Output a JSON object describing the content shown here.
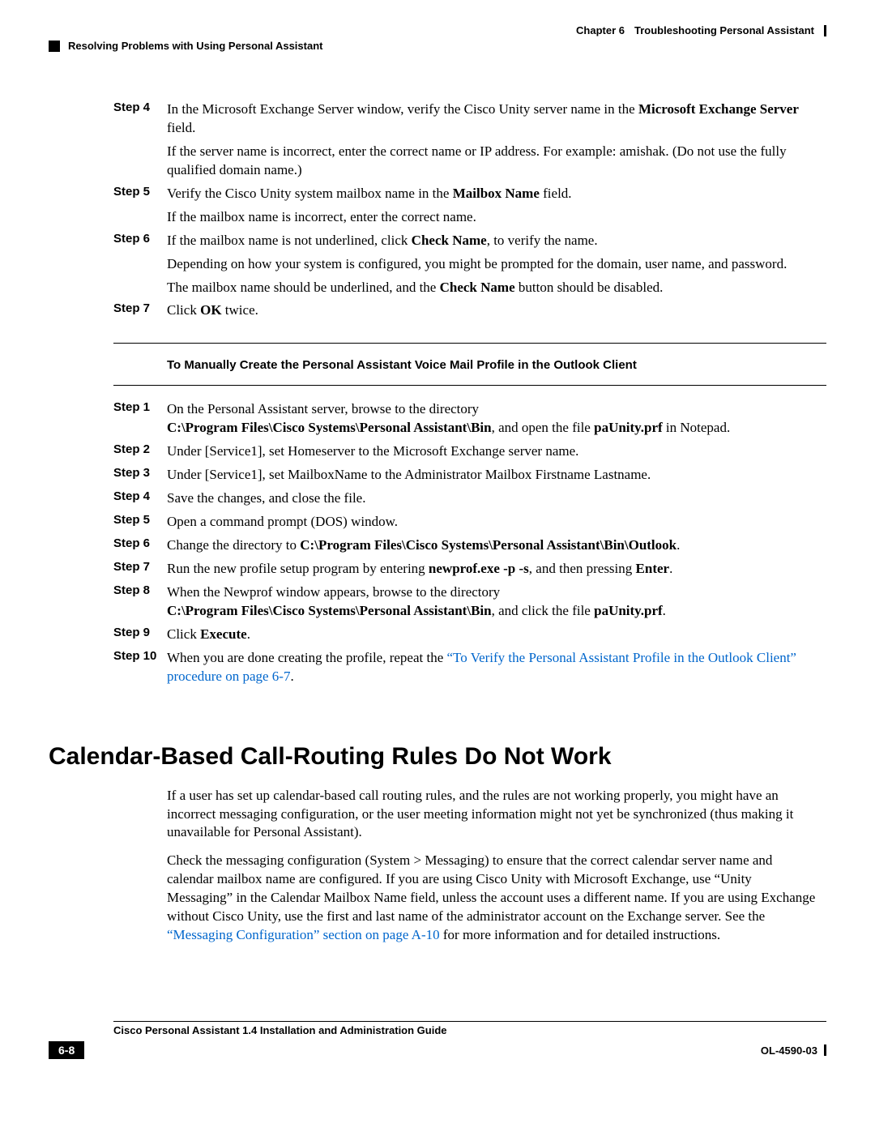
{
  "header": {
    "chapter": "Chapter 6",
    "chapter_title": "Troubleshooting Personal Assistant",
    "section": "Resolving Problems with Using Personal Assistant"
  },
  "steps_a": {
    "s4": {
      "label": "Step 4",
      "t1a": "In the Microsoft Exchange Server window, verify the Cisco Unity server name in the ",
      "t1b": "Microsoft Exchange Server",
      "t1c": " field.",
      "t2": "If the server name is incorrect, enter the correct name or IP address. For example: amishak. (Do not use the fully qualified domain name.)"
    },
    "s5": {
      "label": "Step 5",
      "t1a": "Verify the Cisco Unity system mailbox name in the ",
      "t1b": "Mailbox Name",
      "t1c": " field.",
      "t2": "If the mailbox name is incorrect, enter the correct name."
    },
    "s6": {
      "label": "Step 6",
      "t1a": "If the mailbox name is not underlined, click ",
      "t1b": "Check Name",
      "t1c": ", to verify the name.",
      "t2": "Depending on how your system is configured, you might be prompted for the domain, user name, and password.",
      "t3a": "The mailbox name should be underlined, and the ",
      "t3b": "Check Name",
      "t3c": " button should be disabled."
    },
    "s7": {
      "label": "Step 7",
      "t1a": "Click ",
      "t1b": "OK",
      "t1c": " twice."
    }
  },
  "subheading": "To Manually Create the Personal Assistant Voice Mail Profile in the Outlook Client",
  "steps_b": {
    "s1": {
      "label": "Step 1",
      "t1": "On the Personal Assistant server, browse to the directory ",
      "t2a": "C:\\Program Files\\Cisco Systems\\Personal Assistant\\Bin",
      "t2b": ", and open the file ",
      "t2c": "paUnity.prf",
      "t2d": " in Notepad."
    },
    "s2": {
      "label": "Step 2",
      "t1": "Under [Service1], set Homeserver to the Microsoft Exchange server name."
    },
    "s3": {
      "label": "Step 3",
      "t1": "Under [Service1], set MailboxName to the Administrator Mailbox Firstname Lastname."
    },
    "s4": {
      "label": "Step 4",
      "t1": "Save the changes, and close the file."
    },
    "s5": {
      "label": "Step 5",
      "t1": "Open a command prompt (DOS) window."
    },
    "s6": {
      "label": "Step 6",
      "t1a": "Change the directory to ",
      "t1b": "C:\\Program Files\\Cisco Systems\\Personal Assistant\\Bin\\Outlook",
      "t1c": "."
    },
    "s7": {
      "label": "Step 7",
      "t1a": "Run the new profile setup program by entering ",
      "t1b": "newprof.exe -p -s",
      "t1c": ", and then pressing ",
      "t1d": "Enter",
      "t1e": "."
    },
    "s8": {
      "label": "Step 8",
      "t1": "When the Newprof window appears, browse to the directory ",
      "t2a": "C:\\Program Files\\Cisco Systems\\Personal Assistant\\Bin",
      "t2b": ", and click the file ",
      "t2c": "paUnity.prf",
      "t2d": "."
    },
    "s9": {
      "label": "Step 9",
      "t1a": "Click ",
      "t1b": "Execute",
      "t1c": "."
    },
    "s10": {
      "label": "Step 10",
      "t1a": "When you are done creating the profile, repeat the ",
      "link": "“To Verify the Personal Assistant Profile in the Outlook Client” procedure on page 6-7",
      "t1b": "."
    }
  },
  "h2": "Calendar-Based Call-Routing Rules Do Not Work",
  "para1": "If a user has set up calendar-based call routing rules, and the rules are not working properly, you might have an incorrect messaging configuration, or the user meeting information might not yet be synchronized (thus making it unavailable for Personal Assistant).",
  "para2a": "Check the messaging configuration (System > Messaging) to ensure that the correct calendar server name and calendar mailbox name are configured. If you are using Cisco Unity with Microsoft Exchange, use “Unity Messaging” in the Calendar Mailbox Name field, unless the account uses a different name. If you are using Exchange without Cisco Unity, use the first and last name of the administrator account on the Exchange server. See the ",
  "para2link": "“Messaging Configuration” section on page A-10",
  "para2b": " for more information and for detailed instructions.",
  "footer": {
    "title": "Cisco Personal Assistant 1.4 Installation and Administration Guide",
    "page": "6-8",
    "doc_id": "OL-4590-03"
  }
}
